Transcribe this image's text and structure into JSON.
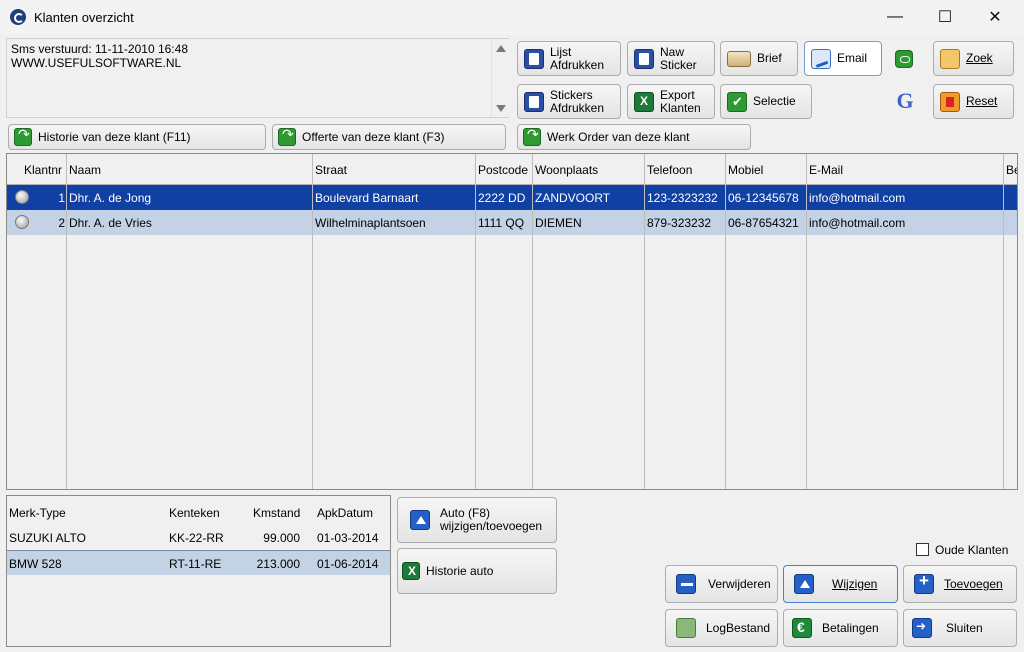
{
  "window": {
    "title": "Klanten overzicht",
    "minimize": "—",
    "maximize": "☐",
    "close": "✕"
  },
  "memo": {
    "text": "Sms verstuurd: 11-11-2010 16:48\nWWW.USEFULSOFTWARE.NL"
  },
  "toolbar": {
    "lijst_afdrukken": "Lijst\nAfdrukken",
    "naw_sticker": "Naw\nSticker",
    "brief": "Brief",
    "email": "Email",
    "zoek": "Zoek",
    "stickers_afdrukken": "Stickers\nAfdrukken",
    "export_klanten": "Export\nKlanten",
    "selectie": "Selectie",
    "reset": "Reset",
    "historie_klant": "Historie van deze klant (F11)",
    "offerte_klant": "Offerte van deze klant (F3)",
    "werkorder_klant": "Werk Order van deze klant"
  },
  "icons": {
    "sms": "sms-icon",
    "google": "G"
  },
  "grid": {
    "columns": [
      "Klantnr",
      "Naam",
      "Straat",
      "Postcode",
      "Woonplaats",
      "Telefoon",
      "Mobiel",
      "E-Mail",
      "Be"
    ],
    "rows": [
      {
        "klantnr": "1",
        "naam": "Dhr. A. de Jong",
        "straat": "Boulevard Barnaart",
        "postcode": "2222 DD",
        "woonplaats": "ZANDVOORT",
        "telefoon": "123-2323232",
        "mobiel": "06-12345678",
        "email": "info@hotmail.com",
        "selected": true
      },
      {
        "klantnr": "2",
        "naam": "Dhr. A. de Vries",
        "straat": "Wilhelminaplantsoen",
        "postcode": "1111 QQ",
        "woonplaats": "DIEMEN",
        "telefoon": "879-323232",
        "mobiel": "06-87654321",
        "email": "info@hotmail.com",
        "selected": false
      }
    ]
  },
  "cars": {
    "columns": [
      "Merk-Type",
      "Kenteken",
      "Kmstand",
      "ApkDatum"
    ],
    "rows": [
      {
        "merk": "SUZUKI ALTO",
        "kenteken": "KK-22-RR",
        "kmstand": "99.000",
        "apk": "01-03-2014"
      },
      {
        "merk": "BMW 528",
        "kenteken": "RT-11-RE",
        "kmstand": "213.000",
        "apk": "01-06-2014"
      }
    ]
  },
  "carbuttons": {
    "auto": "Auto (F8)\nwijzigen/toevoegen",
    "historie_auto": "Historie auto"
  },
  "bottom": {
    "oude_klanten": "Oude Klanten",
    "verwijderen": "Verwijderen",
    "wijzigen": "Wijzigen",
    "toevoegen": "Toevoegen",
    "logbestand": "LogBestand",
    "betalingen": "Betalingen",
    "sluiten": "Sluiten"
  },
  "colors": {
    "selection": "#1140a4",
    "alt_row": "#c3d2e5",
    "accent_blue": "#2460c8",
    "accent_green": "#2e9a33"
  }
}
